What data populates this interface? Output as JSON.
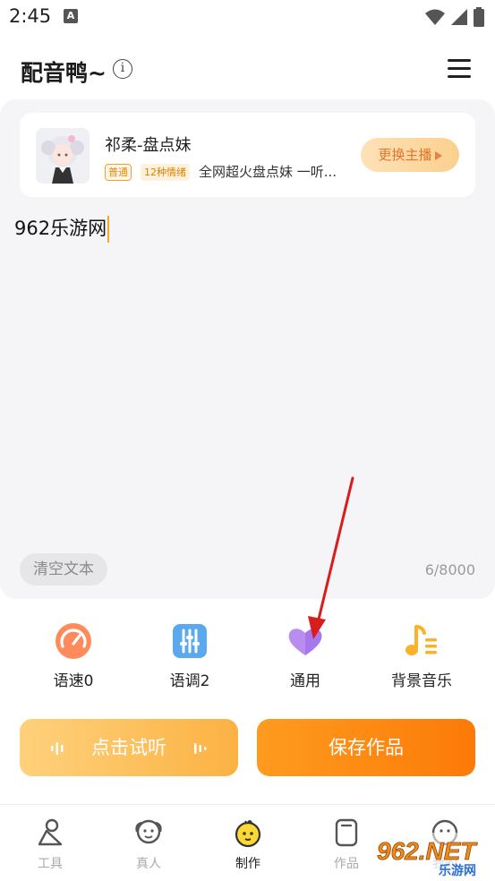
{
  "status": {
    "time": "2:45",
    "notice_glyph": "A"
  },
  "header": {
    "title": "配音鸭~",
    "info_glyph": "i"
  },
  "voice": {
    "name": "祁柔-盘点妹",
    "tag_normal": "普通",
    "tag_emotion": "12种情绪",
    "description": "全网超火盘点妹 一听...",
    "change_label": "更换主播"
  },
  "editor": {
    "text": "962乐游网",
    "clear_label": "清空文本",
    "char_count": "6/8000"
  },
  "tools": [
    {
      "label": "语速0",
      "icon": "speed-gauge-icon"
    },
    {
      "label": "语调2",
      "icon": "tone-sliders-icon"
    },
    {
      "label": "通用",
      "icon": "heart-icon"
    },
    {
      "label": "背景音乐",
      "icon": "music-note-icon"
    }
  ],
  "actions": {
    "listen_label": "点击试听",
    "save_label": "保存作品"
  },
  "nav": [
    {
      "label": "工具",
      "icon": "tools-icon"
    },
    {
      "label": "真人",
      "icon": "human-voice-icon"
    },
    {
      "label": "制作",
      "icon": "duck-icon"
    },
    {
      "label": "作品",
      "icon": "works-icon"
    },
    {
      "label": "我的",
      "icon": "profile-icon"
    }
  ],
  "watermark": {
    "text": "962.NET",
    "sub": "乐游网"
  },
  "colors": {
    "accent": "#fc8a10",
    "accent_light": "#fed17c",
    "panel": "#f5f5f7",
    "arrow": "#e02020"
  }
}
